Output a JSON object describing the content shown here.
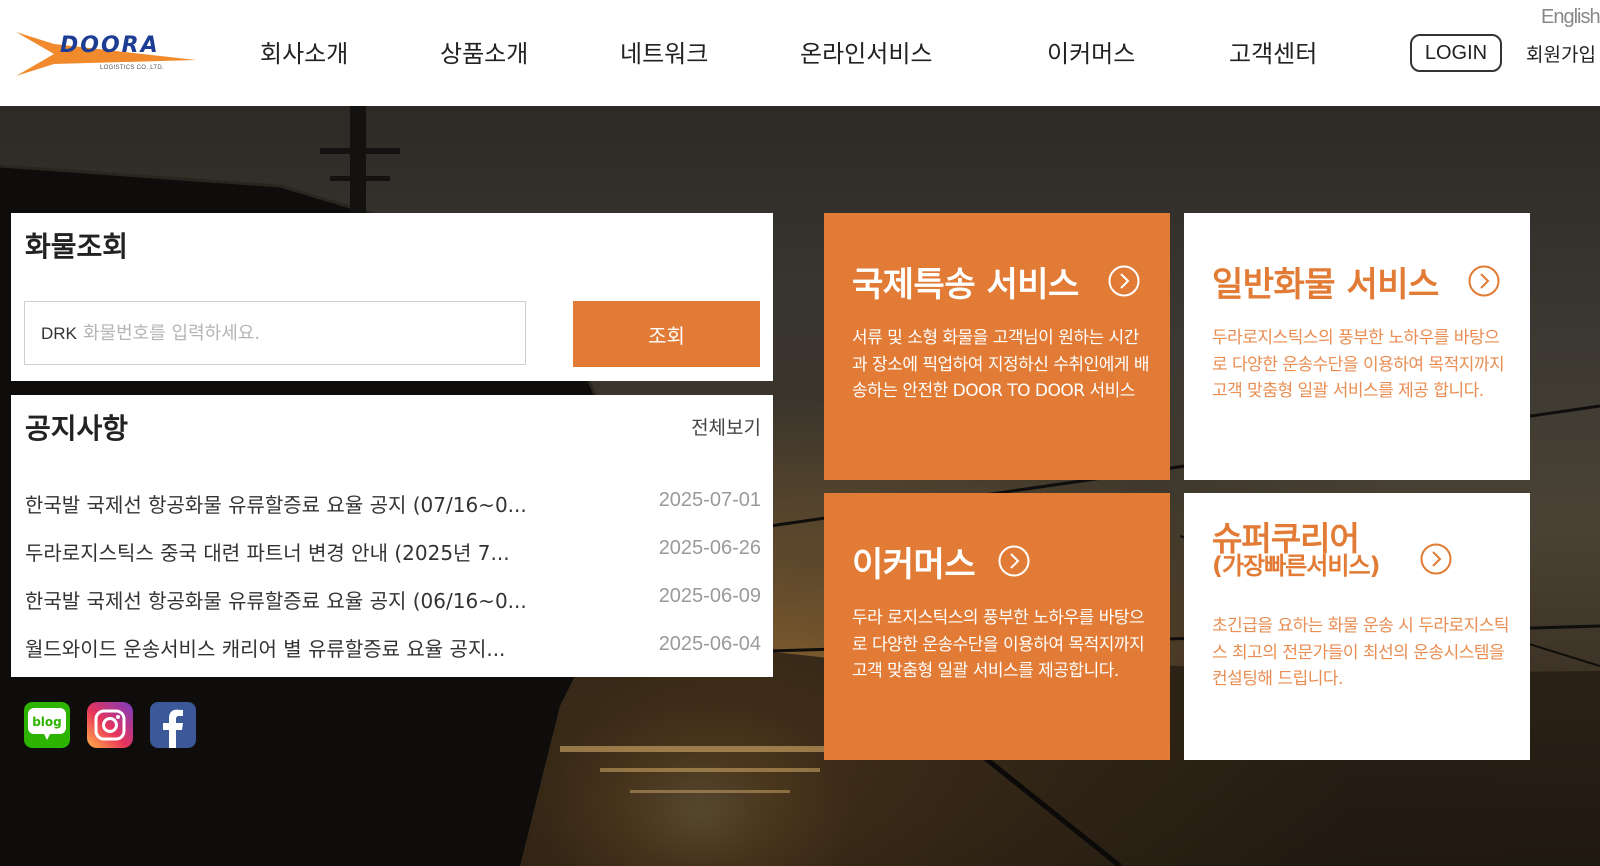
{
  "brand": {
    "logo_text": "DOORA",
    "logo_subtext": "LOGISTICS CO.,LTD."
  },
  "header": {
    "nav": [
      "회사소개",
      "상품소개",
      "네트워크",
      "온라인서비스",
      "이커머스",
      "고객센터"
    ],
    "login_label": "LOGIN",
    "join_label": "회원가입",
    "english_label": "English"
  },
  "cargo_search": {
    "title": "화물조회",
    "prefix": "DRK",
    "placeholder": "화물번호를 입력하세요.",
    "button_label": "조회"
  },
  "notices": {
    "title": "공지사항",
    "view_all_label": "전체보기",
    "items": [
      {
        "title": "한국발 국제선 항공화물 유류할증료 요율 공지 (07/16~0...",
        "date": "2025-07-01"
      },
      {
        "title": "두라로지스틱스 중국 대련 파트너 변경 안내 (2025년 7...",
        "date": "2025-06-26"
      },
      {
        "title": "한국발 국제선 항공화물 유류할증료 요율 공지 (06/16~0...",
        "date": "2025-06-09"
      },
      {
        "title": "월드와이드 운송서비스 캐리어 별 유류할증료 요율 공지...",
        "date": "2025-06-04"
      }
    ]
  },
  "social": {
    "blog_label": "blog",
    "icons": [
      "blog-icon",
      "instagram-icon",
      "facebook-icon"
    ]
  },
  "services": [
    {
      "title": "국제특송 서비스",
      "desc": "서류 및 소형 화물을 고객님이 원하는 시간과 장소에 픽업하여 지정하신 수취인에게 배송하는 안전한 DOOR TO DOOR 서비스",
      "style": "orange"
    },
    {
      "title": "일반화물 서비스",
      "desc": "두라로지스틱스의 풍부한 노하우를 바탕으로 다양한 운송수단을 이용하여 목적지까지 고객 맞춤형 일괄 서비스를 제공 합니다.",
      "style": "white"
    },
    {
      "title": "이커머스",
      "desc": "두라 로지스틱스의 풍부한 노하우를 바탕으로 다양한 운송수단을 이용하여 목적지까지 고객 맞춤형 일괄 서비스를 제공합니다.",
      "style": "orange"
    },
    {
      "title": "슈퍼쿠리어",
      "subtitle": "(가장빠른서비스)",
      "desc": "초긴급을 요하는 화물 운송 시 두라로지스틱스 최고의 전문가들이 최선의 운송시스템을 컨설팅해 드립니다.",
      "style": "white"
    }
  ],
  "colors": {
    "accent": "#e27b35",
    "brand_blue": "#1d3c93",
    "text": "#222222",
    "muted": "#9a9a9a"
  }
}
